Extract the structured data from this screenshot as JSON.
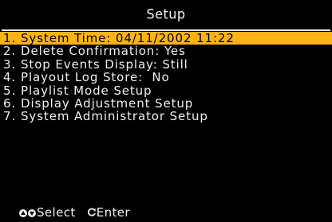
{
  "header": {
    "title": "Setup"
  },
  "menu": {
    "items": [
      {
        "number": "1.",
        "label": "System Time: 04/11/2002 11:22",
        "selected": true
      },
      {
        "number": "2.",
        "label": "Delete Confirmation: Yes",
        "selected": false
      },
      {
        "number": "3.",
        "label": "Stop Events Display: Still",
        "selected": false
      },
      {
        "number": "4.",
        "label": "Playout Log Store:  No",
        "selected": false
      },
      {
        "number": "5.",
        "label": "Playlist Mode Setup",
        "selected": false
      },
      {
        "number": "6.",
        "label": "Display Adjustment Setup",
        "selected": false
      },
      {
        "number": "7.",
        "label": "System Administrator Setup",
        "selected": false
      }
    ]
  },
  "footer": {
    "select_label": "Select",
    "enter_label": "Enter",
    "icons": [
      "up-arrow-icon",
      "down-arrow-icon",
      "enter-icon"
    ]
  },
  "colors": {
    "background": "#000000",
    "text": "#f2f2f2",
    "highlight": "#ffb218",
    "highlight_text": "#000000"
  }
}
